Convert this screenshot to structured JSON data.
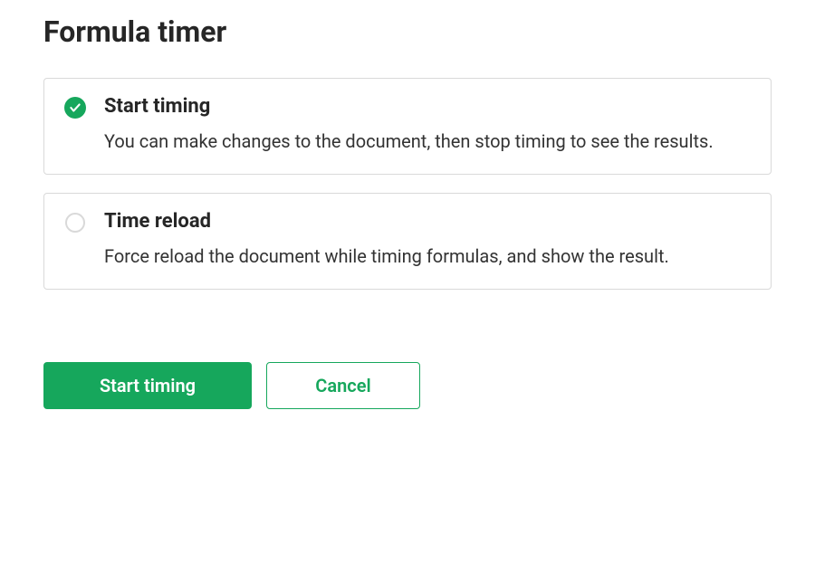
{
  "title": "Formula timer",
  "options": [
    {
      "id": "start-timing",
      "label": "Start timing",
      "description": "You can make changes to the document, then stop timing to see the results.",
      "selected": true
    },
    {
      "id": "time-reload",
      "label": "Time reload",
      "description": "Force reload the document while timing formulas, and show the result.",
      "selected": false
    }
  ],
  "buttons": {
    "primary": "Start timing",
    "secondary": "Cancel"
  },
  "colors": {
    "accent": "#16a75c",
    "border": "#d9d9d9",
    "text": "#262626"
  }
}
